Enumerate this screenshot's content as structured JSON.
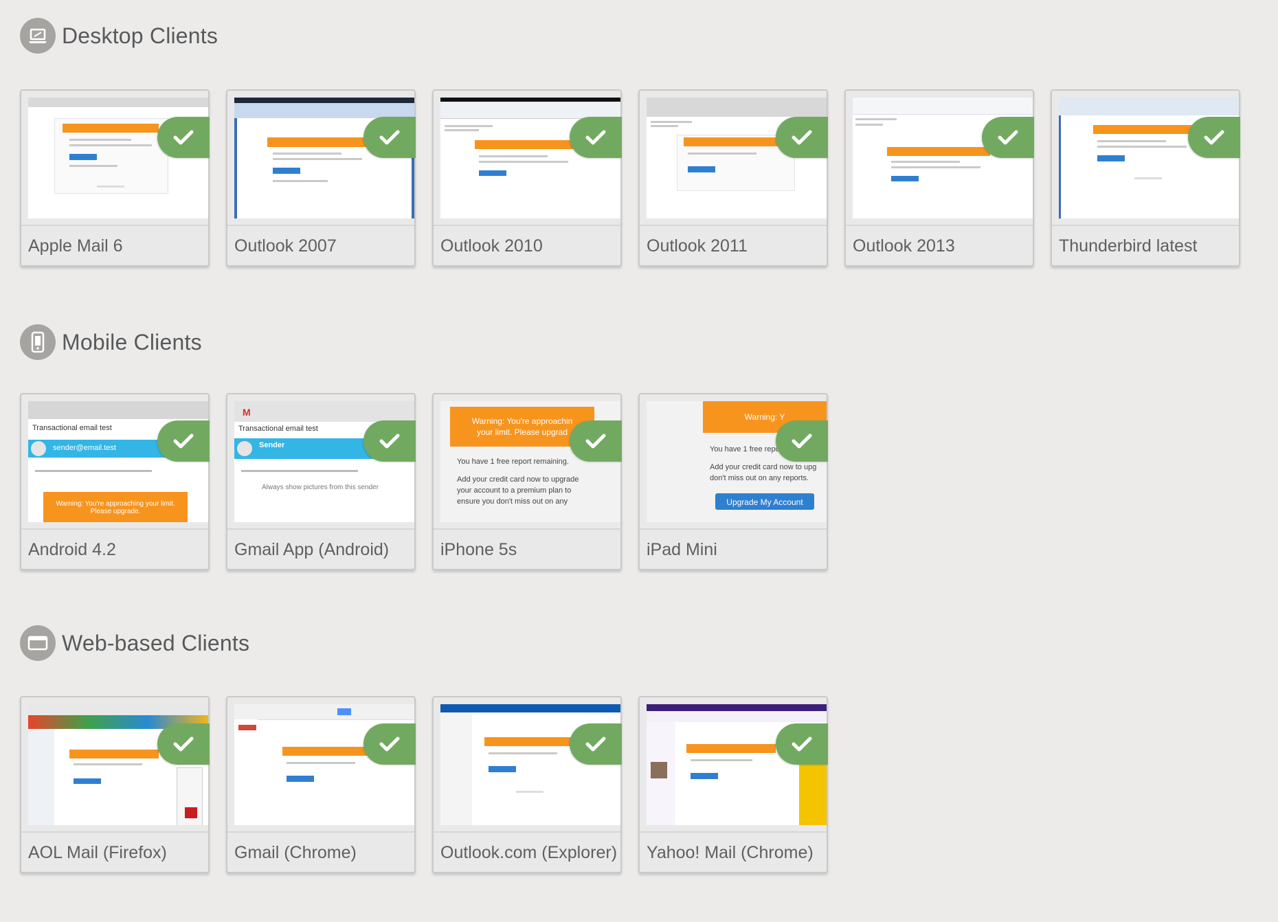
{
  "sections": [
    {
      "title": "Desktop Clients",
      "icon": "laptop-icon",
      "clients": [
        {
          "label": "Apple Mail 6",
          "status": "check"
        },
        {
          "label": "Outlook 2007",
          "status": "check"
        },
        {
          "label": "Outlook 2010",
          "status": "check"
        },
        {
          "label": "Outlook 2011",
          "status": "check"
        },
        {
          "label": "Outlook 2013",
          "status": "check"
        },
        {
          "label": "Thunderbird latest",
          "status": "check"
        }
      ]
    },
    {
      "title": "Mobile Clients",
      "icon": "mobile-phone-icon",
      "clients": [
        {
          "label": "Android 4.2",
          "status": "check"
        },
        {
          "label": "Gmail App (Android)",
          "status": "check"
        },
        {
          "label": "iPhone 5s",
          "status": "check"
        },
        {
          "label": "iPad Mini",
          "status": "check"
        }
      ]
    },
    {
      "title": "Web-based Clients",
      "icon": "browser-window-icon",
      "clients": [
        {
          "label": "AOL Mail (Firefox)",
          "status": "check"
        },
        {
          "label": "Gmail (Chrome)",
          "status": "check"
        },
        {
          "label": "Outlook.com (Explorer)",
          "status": "check"
        },
        {
          "label": "Yahoo! Mail (Chrome)",
          "status": "check"
        }
      ]
    }
  ],
  "preview_text": {
    "android_subject": "Transactional email test",
    "android_sender": "sender@email.test",
    "android_warning": "Warning: You're approaching your limit. Please upgrade.",
    "iphone_warning_1": "Warning: You're approachin",
    "iphone_warning_2": "your limit. Please upgrad",
    "iphone_body_1": "You have 1 free report remaining.",
    "iphone_body_2": "Add your credit card now to upgrade",
    "iphone_body_3": "your account to a premium plan to",
    "iphone_body_4": "ensure you don't miss out on any",
    "ipad_warning": "Warning: Y",
    "ipad_body_1": "You have 1 free report remaini",
    "ipad_body_2": "Add your credit card now to upg",
    "ipad_body_3": "don't miss out on any reports.",
    "ipad_button": "Upgrade My Account",
    "gmail_app_subject": "Transactional email test",
    "gmail_app_sender": "Sender",
    "gmail_app_images": "Always show pictures from this sender"
  },
  "colors": {
    "background": "#ecebe9",
    "check_badge": "#72a960",
    "banner_orange": "#f7941d",
    "button_blue": "#2f7fd1",
    "section_icon": "#a5a4a1"
  }
}
